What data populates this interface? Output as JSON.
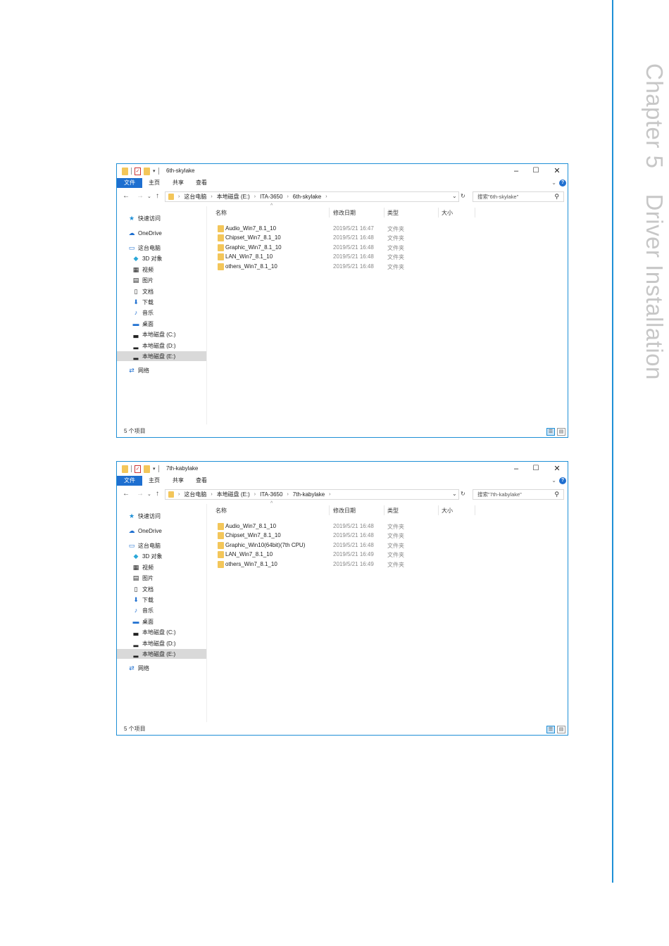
{
  "side_heading": {
    "chapter": "Chapter 5",
    "title": "Driver Installation"
  },
  "windows": [
    {
      "title": "6th-skylake",
      "tabs": [
        "文件",
        "主页",
        "共享",
        "查看"
      ],
      "breadcrumb": [
        "这台电脑",
        "本地磁盘 (E:)",
        "ITA-3650",
        "6th-skylake"
      ],
      "search_placeholder": "搜索\"6th-skylake\"",
      "nav": {
        "quick_access": "快速访问",
        "onedrive": "OneDrive",
        "this_pc": "这台电脑",
        "objects_3d": "3D 对象",
        "videos": "视频",
        "pictures": "图片",
        "documents": "文档",
        "downloads": "下载",
        "music": "音乐",
        "desktop": "桌面",
        "drive_c": "本地磁盘 (C:)",
        "drive_d": "本地磁盘 (D:)",
        "drive_e": "本地磁盘 (E:)",
        "network": "网络"
      },
      "columns": {
        "name": "名称",
        "date": "修改日期",
        "type": "类型",
        "size": "大小"
      },
      "files": [
        {
          "name": "Audio_Win7_8.1_10",
          "date": "2019/5/21 16:47",
          "type": "文件夹"
        },
        {
          "name": "Chipset_Win7_8.1_10",
          "date": "2019/5/21 16:48",
          "type": "文件夹"
        },
        {
          "name": "Graphic_Win7_8.1_10",
          "date": "2019/5/21 16:48",
          "type": "文件夹"
        },
        {
          "name": "LAN_Win7_8.1_10",
          "date": "2019/5/21 16:48",
          "type": "文件夹"
        },
        {
          "name": "others_Win7_8.1_10",
          "date": "2019/5/21 16:48",
          "type": "文件夹"
        }
      ],
      "status": "5 个项目"
    },
    {
      "title": "7th-kabylake",
      "tabs": [
        "文件",
        "主页",
        "共享",
        "查看"
      ],
      "breadcrumb": [
        "这台电脑",
        "本地磁盘 (E:)",
        "ITA-3650",
        "7th-kabylake"
      ],
      "search_placeholder": "搜索\"7th-kabylake\"",
      "nav": {
        "quick_access": "快速访问",
        "onedrive": "OneDrive",
        "this_pc": "这台电脑",
        "objects_3d": "3D 对象",
        "videos": "视频",
        "pictures": "图片",
        "documents": "文档",
        "downloads": "下载",
        "music": "音乐",
        "desktop": "桌面",
        "drive_c": "本地磁盘 (C:)",
        "drive_d": "本地磁盘 (D:)",
        "drive_e": "本地磁盘 (E:)",
        "network": "网络"
      },
      "columns": {
        "name": "名称",
        "date": "修改日期",
        "type": "类型",
        "size": "大小"
      },
      "files": [
        {
          "name": "Audio_Win7_8.1_10",
          "date": "2019/5/21 16:48",
          "type": "文件夹"
        },
        {
          "name": "Chipset_Win7_8.1_10",
          "date": "2019/5/21 16:48",
          "type": "文件夹"
        },
        {
          "name": "Graphic_Win10(64bit)(7th CPU)",
          "date": "2019/5/21 16:48",
          "type": "文件夹"
        },
        {
          "name": "LAN_Win7_8.1_10",
          "date": "2019/5/21 16:49",
          "type": "文件夹"
        },
        {
          "name": "others_Win7_8.1_10",
          "date": "2019/5/21 16:49",
          "type": "文件夹"
        }
      ],
      "status": "5 个项目"
    }
  ],
  "colors": {
    "accent": "#1e8fd6",
    "folder": "#f3c65a",
    "file_tab": "#1e6fd0"
  },
  "icons": [
    "folder-icon",
    "back-arrow-icon",
    "forward-arrow-icon",
    "up-arrow-icon",
    "refresh-icon",
    "search-icon",
    "minimize-icon",
    "maximize-icon",
    "close-icon",
    "help-icon"
  ]
}
